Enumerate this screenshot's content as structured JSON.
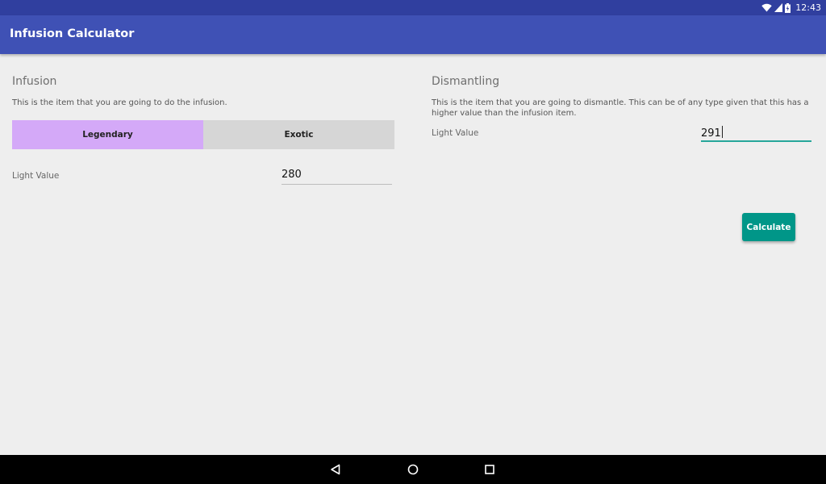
{
  "status_bar": {
    "time": "12:43",
    "icons": [
      "wifi-icon",
      "signal-icon",
      "battery-charging-icon"
    ],
    "color": "#303f9f"
  },
  "app_bar": {
    "title": "Infusion Calculator",
    "color": "#3f51b5"
  },
  "infusion": {
    "title": "Infusion",
    "description": "This is the item that you are going to do the infusion.",
    "options": [
      "Legendary",
      "Exotic"
    ],
    "selected": "Legendary",
    "selected_color": "#d4a9f8",
    "light_label": "Light Value",
    "light_value": "280"
  },
  "dismantling": {
    "title": "Dismantling",
    "description_line1": "This is the item that you are going to dismantle. This can be of any type given that this has a",
    "description_line2": "higher value than the infusion item.",
    "light_label": "Light Value",
    "light_value": "291"
  },
  "calculate": {
    "label": "Calculate",
    "color": "#009688"
  },
  "nav_bar": {
    "icons": [
      "back-icon",
      "home-icon",
      "recents-icon"
    ]
  }
}
